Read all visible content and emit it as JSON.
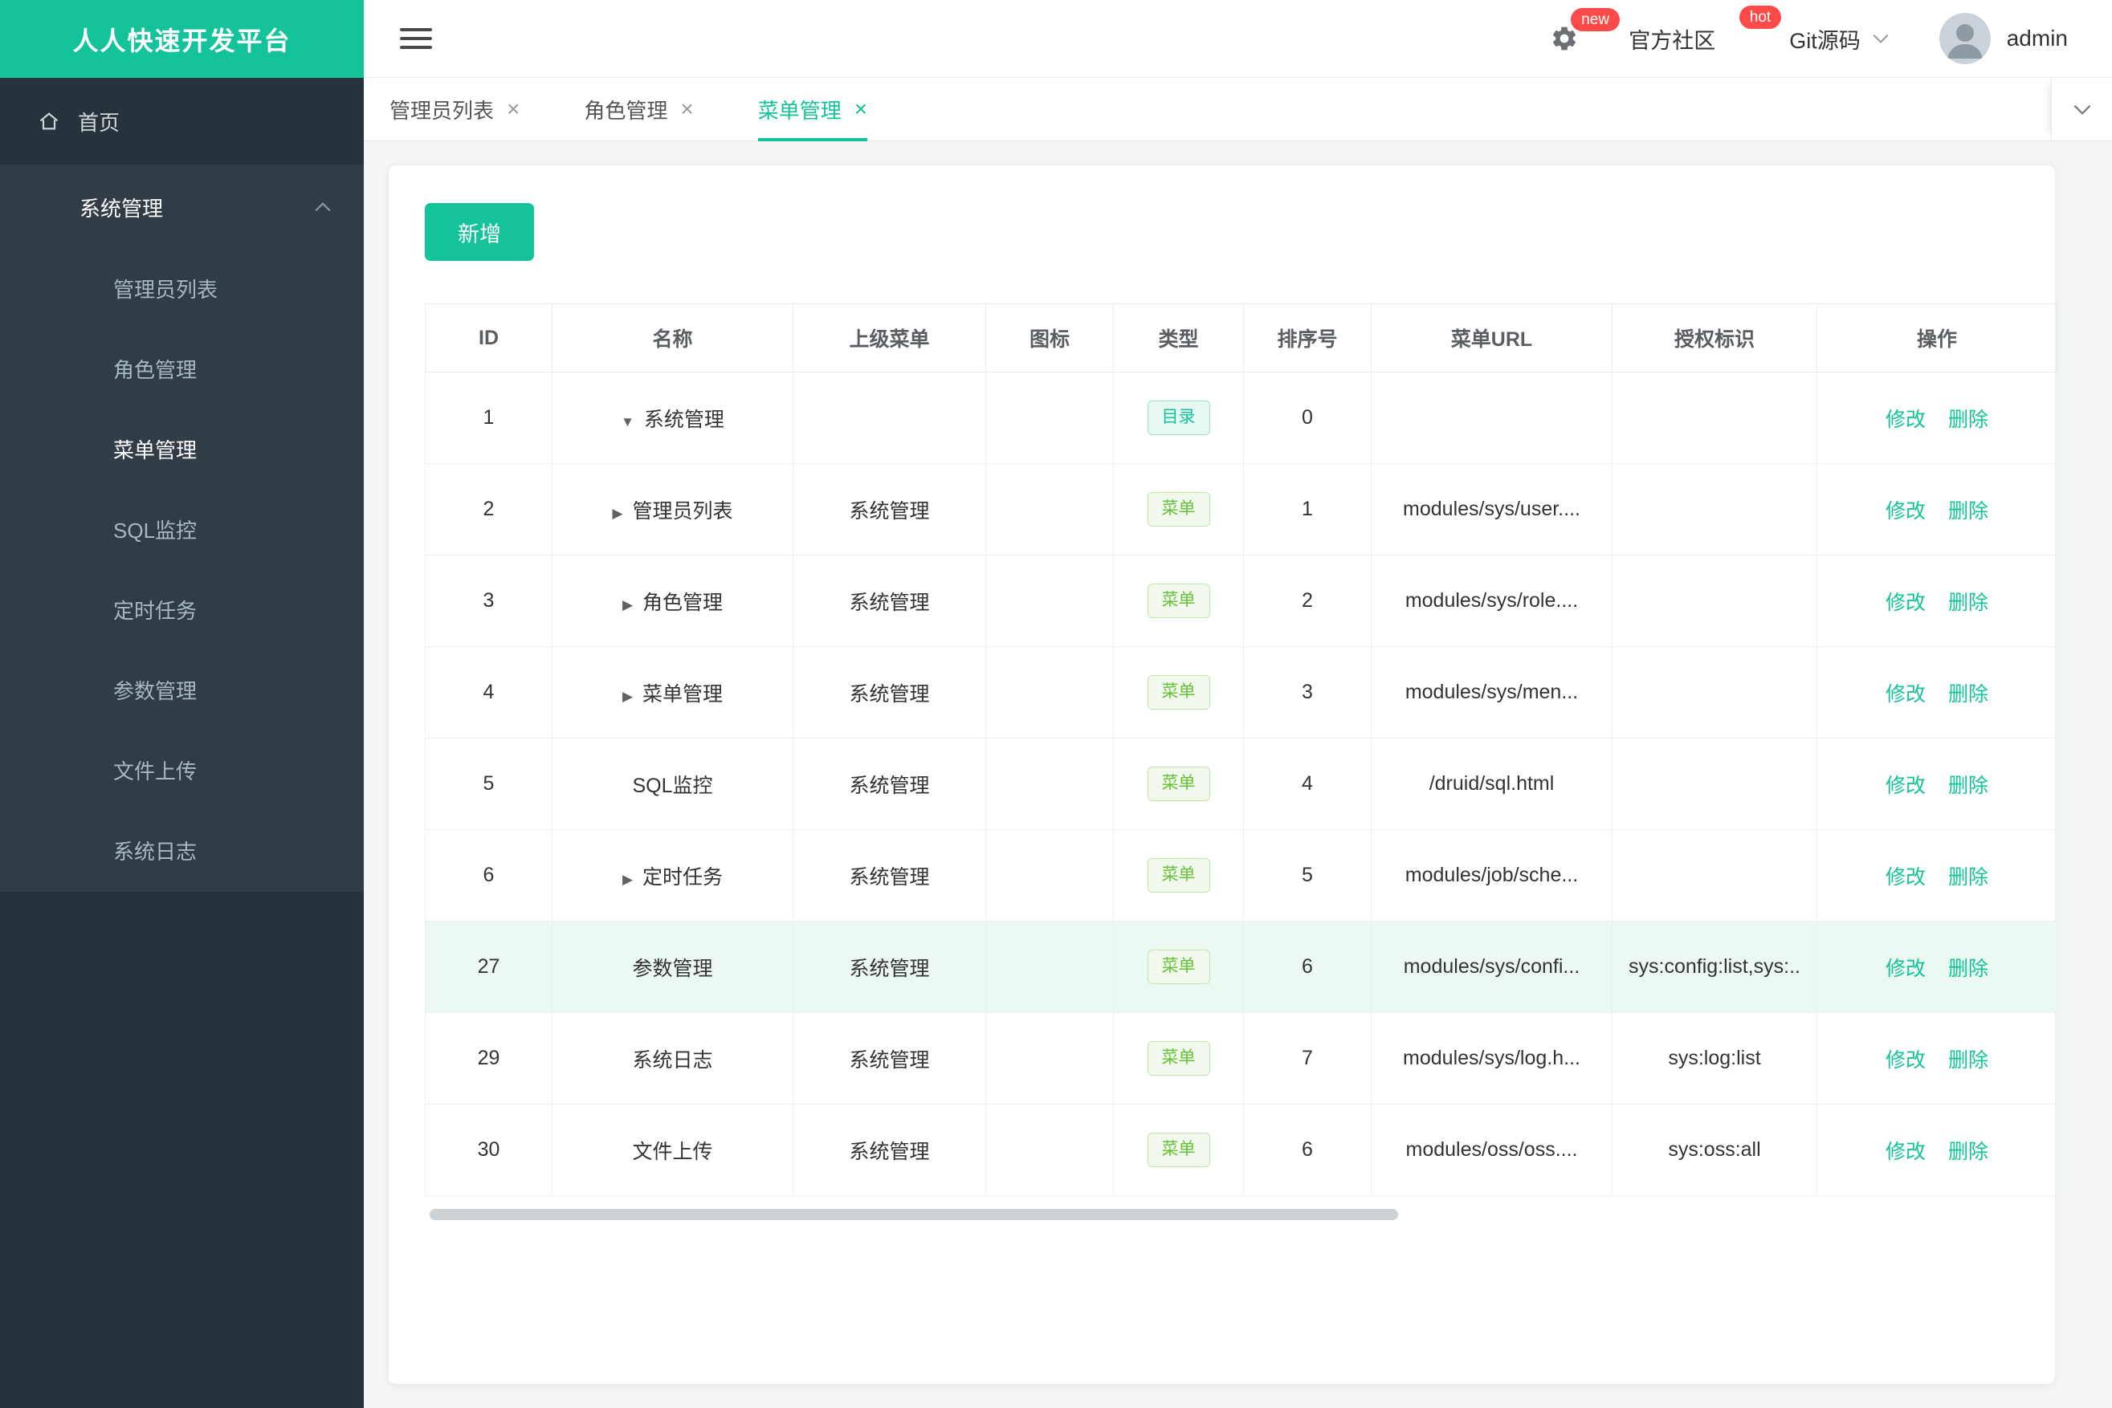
{
  "colors": {
    "accent": "#15c39a",
    "badge_red": "#ff4a4a",
    "tag_dir": "#15c39a",
    "tag_menu": "#67c23a",
    "sidebar_bg": "#28323a",
    "sidebar_group_bg": "#313d46"
  },
  "icons": {
    "close": "×",
    "caret_down": "▼",
    "caret_right": "▶"
  },
  "brand": {
    "title": "人人快速开发平台"
  },
  "topbar": {
    "gear_badge": "new",
    "community_label": "官方社区",
    "community_badge": "hot",
    "git_label": "Git源码",
    "user_name": "admin"
  },
  "sidebar": {
    "home_label": "首页",
    "group_label": "系统管理",
    "items": [
      {
        "label": "管理员列表",
        "active": false
      },
      {
        "label": "角色管理",
        "active": false
      },
      {
        "label": "菜单管理",
        "active": true
      },
      {
        "label": "SQL监控",
        "active": false
      },
      {
        "label": "定时任务",
        "active": false
      },
      {
        "label": "参数管理",
        "active": false
      },
      {
        "label": "文件上传",
        "active": false
      },
      {
        "label": "系统日志",
        "active": false
      }
    ]
  },
  "tabs": [
    {
      "label": "管理员列表",
      "active": false
    },
    {
      "label": "角色管理",
      "active": false
    },
    {
      "label": "菜单管理",
      "active": true
    }
  ],
  "toolbar": {
    "add_label": "新增"
  },
  "table": {
    "headers": [
      "ID",
      "名称",
      "上级菜单",
      "图标",
      "类型",
      "排序号",
      "菜单URL",
      "授权标识",
      "操作"
    ],
    "type_labels": {
      "dir": "目录",
      "menu": "菜单"
    },
    "actions": {
      "edit": "修改",
      "delete": "删除"
    },
    "rows": [
      {
        "id": "1",
        "caret": "down",
        "name": "系统管理",
        "parent": "",
        "icon": "",
        "type": "dir",
        "order": "0",
        "url": "",
        "perm": "",
        "highlight": false
      },
      {
        "id": "2",
        "caret": "right",
        "name": "管理员列表",
        "parent": "系统管理",
        "icon": "",
        "type": "menu",
        "order": "1",
        "url": "modules/sys/user....",
        "perm": "",
        "highlight": false
      },
      {
        "id": "3",
        "caret": "right",
        "name": "角色管理",
        "parent": "系统管理",
        "icon": "",
        "type": "menu",
        "order": "2",
        "url": "modules/sys/role....",
        "perm": "",
        "highlight": false
      },
      {
        "id": "4",
        "caret": "right",
        "name": "菜单管理",
        "parent": "系统管理",
        "icon": "",
        "type": "menu",
        "order": "3",
        "url": "modules/sys/men...",
        "perm": "",
        "highlight": false
      },
      {
        "id": "5",
        "caret": "",
        "name": "SQL监控",
        "parent": "系统管理",
        "icon": "",
        "type": "menu",
        "order": "4",
        "url": "/druid/sql.html",
        "perm": "",
        "highlight": false
      },
      {
        "id": "6",
        "caret": "right",
        "name": "定时任务",
        "parent": "系统管理",
        "icon": "",
        "type": "menu",
        "order": "5",
        "url": "modules/job/sche...",
        "perm": "",
        "highlight": false
      },
      {
        "id": "27",
        "caret": "",
        "name": "参数管理",
        "parent": "系统管理",
        "icon": "",
        "type": "menu",
        "order": "6",
        "url": "modules/sys/confi...",
        "perm": "sys:config:list,sys:..",
        "highlight": true
      },
      {
        "id": "29",
        "caret": "",
        "name": "系统日志",
        "parent": "系统管理",
        "icon": "",
        "type": "menu",
        "order": "7",
        "url": "modules/sys/log.h...",
        "perm": "sys:log:list",
        "highlight": false
      },
      {
        "id": "30",
        "caret": "",
        "name": "文件上传",
        "parent": "系统管理",
        "icon": "",
        "type": "menu",
        "order": "6",
        "url": "modules/oss/oss....",
        "perm": "sys:oss:all",
        "highlight": false
      }
    ]
  }
}
